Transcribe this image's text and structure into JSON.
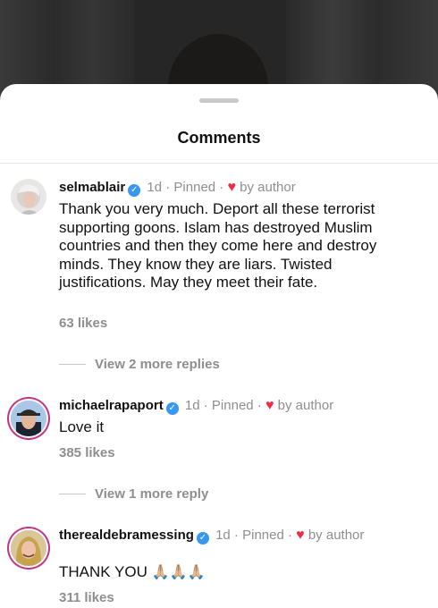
{
  "sheet": {
    "title": "Comments"
  },
  "comments": [
    {
      "username": "selmablair",
      "time": "1d",
      "pinned": "Pinned",
      "by_author": "by author",
      "text": "Thank you very much. Deport all these terrorist supporting goons. Islam has destroyed Muslim countries and then they come here and destroy minds.  They know they are liars. Twisted justifications. May they meet their fate.",
      "likes": "63 likes",
      "replies": "View 2 more replies"
    },
    {
      "username": "michaelrapaport",
      "time": "1d",
      "pinned": "Pinned",
      "by_author": "by author",
      "text": "Love it",
      "likes": "385 likes",
      "replies": "View 1 more reply"
    },
    {
      "username": "therealdebramessing",
      "time": "1d",
      "pinned": "Pinned",
      "by_author": "by author",
      "text": "THANK YOU",
      "emoji": "🙏🏼🙏🏼🙏🏼",
      "likes": "311 likes"
    }
  ],
  "colors": {
    "heart": "#ed2c43",
    "verified": "#3897f0",
    "secondary_text": "#8e8e8e"
  }
}
